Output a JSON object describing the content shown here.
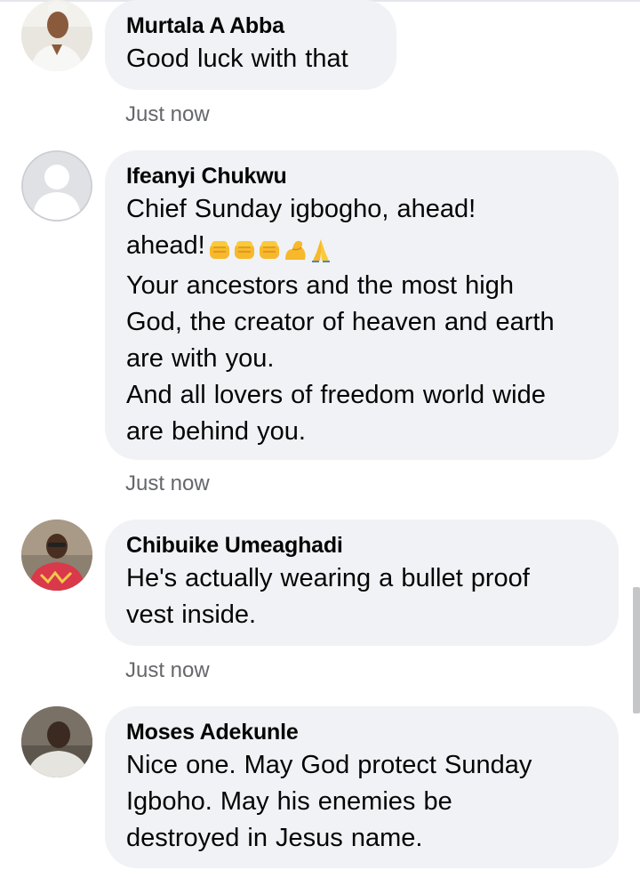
{
  "comments": [
    {
      "author": "Murtala A Abba",
      "text": "Good luck with that",
      "time": "Just now",
      "avatar_icon": "user-photo-icon"
    },
    {
      "author": "Ifeanyi Chukwu",
      "line1": "Chief Sunday  igbogho,  ahead!",
      "line2": "ahead!",
      "emojis": [
        "raised-fist-emoji",
        "raised-fist-emoji",
        "raised-fist-emoji",
        "flexed-biceps-emoji",
        "folded-hands-emoji"
      ],
      "rest": "Your  ancestors and  the  most  high\nGod, the creator of heaven and earth\nare with  you.\nAnd  all lovers of freedom world wide\nare  behind  you.",
      "time": "Just now",
      "avatar_icon": "default-profile-icon"
    },
    {
      "author": "Chibuike Umeaghadi",
      "text": "He's actually wearing a bullet proof\nvest inside.",
      "time": "Just now",
      "avatar_icon": "user-photo-icon"
    },
    {
      "author": "Moses Adekunle",
      "text": "Nice one.  May God protect Sunday\nIgboho.  May his enemies be\ndestroyed in Jesus name.",
      "avatar_icon": "user-photo-icon"
    }
  ],
  "colors": {
    "bubble": "#f0f2f5",
    "timestamp": "#65676b",
    "text": "#050505"
  }
}
